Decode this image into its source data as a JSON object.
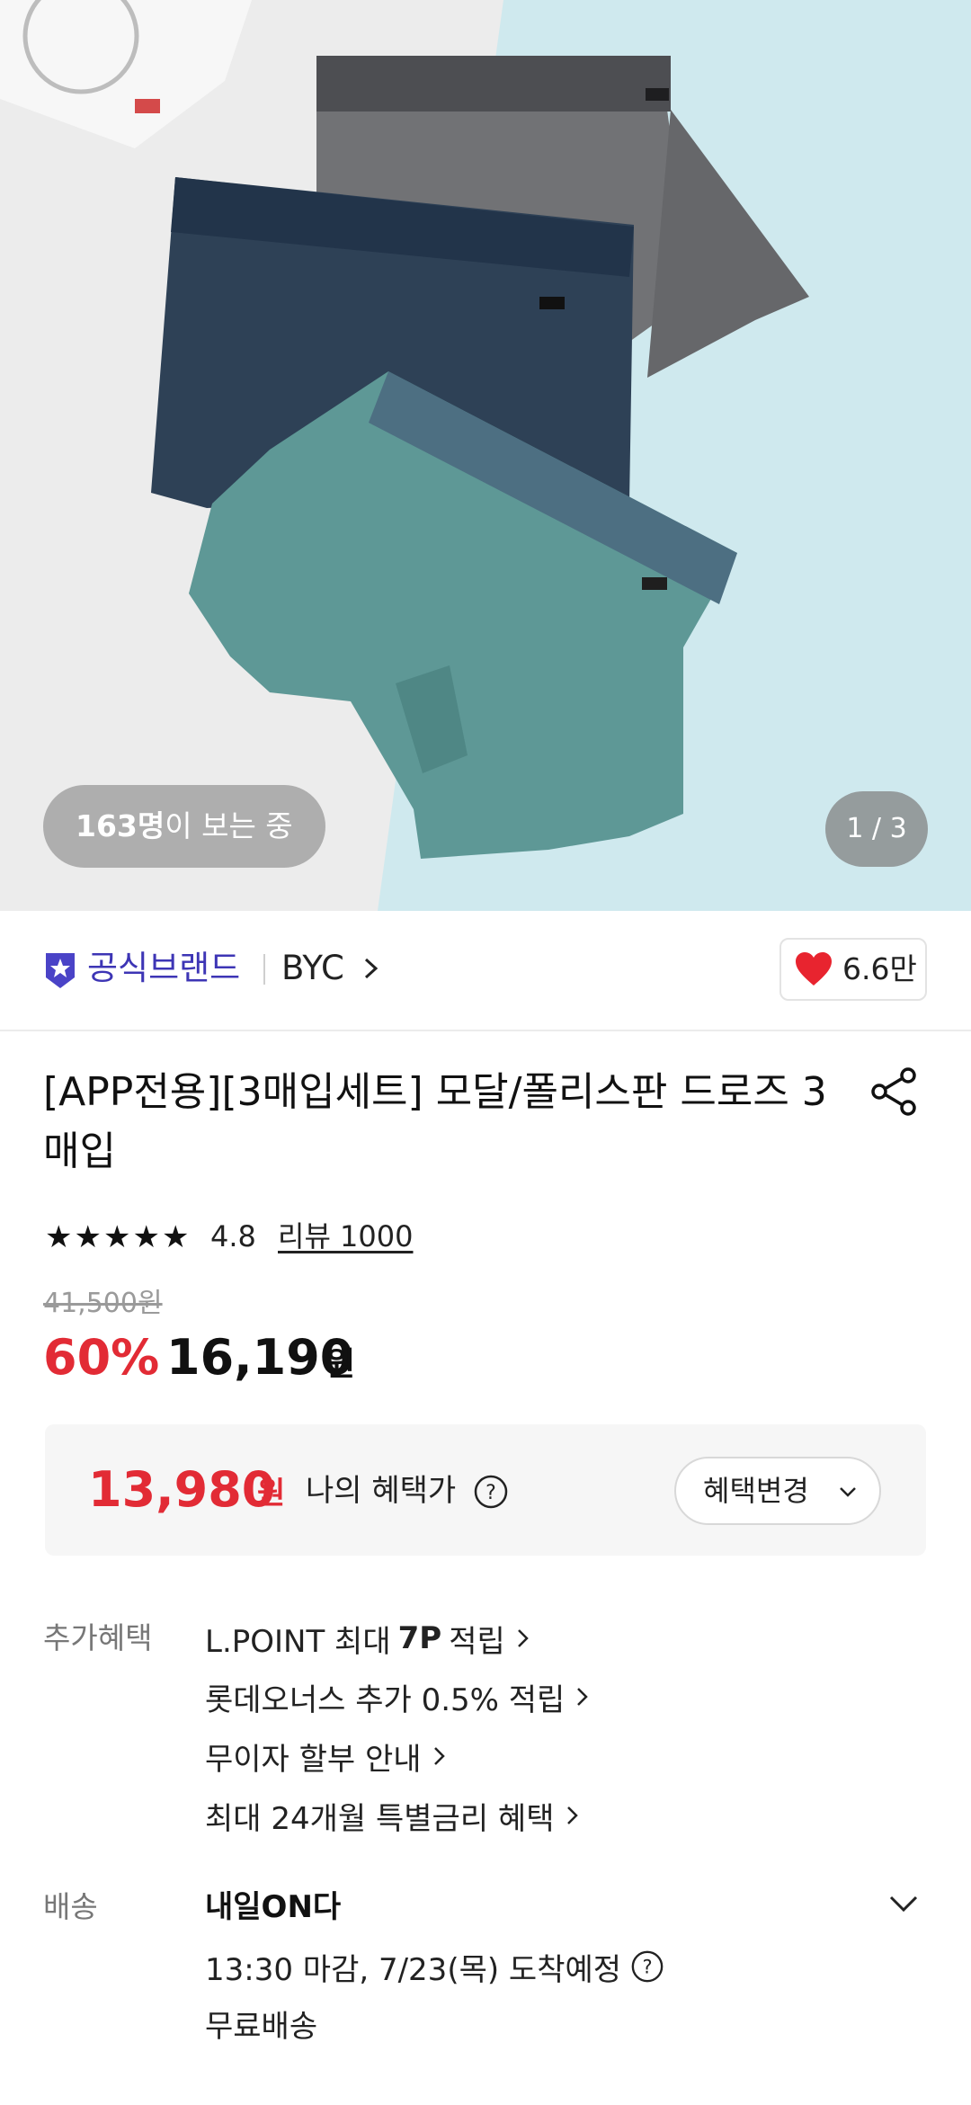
{
  "hero": {
    "viewers_count": "163명",
    "viewers_suffix": "이 보는 중",
    "pager": "1 / 3",
    "colors": {
      "left_bg": "#ececec",
      "right_bg": "#cfe9ee",
      "shorts_gray": "#6b6c6f",
      "shorts_navy": "#2b3e52",
      "shorts_teal": "#5f9a98"
    }
  },
  "brand": {
    "official_label": "공식브랜드",
    "name": "BYC",
    "likes": "6.6만",
    "accent_color": "#3d35b5"
  },
  "product": {
    "title": "[APP전용][3매입세트] 모달/폴리스판 드로즈 3매입",
    "rating": "4.8",
    "reviews": "리뷰 1000",
    "original_price": "41,500원",
    "discount": "60%",
    "price": "16,190",
    "price_unit": "원"
  },
  "benefit_price": {
    "price": "13,980",
    "unit": "원",
    "label": "나의 혜택가",
    "change_button": "혜택변경"
  },
  "extra_benefits": {
    "label": "추가혜택",
    "items": [
      {
        "prefix": "L.POINT 최대",
        "bold": "7P",
        "suffix": "적립"
      },
      {
        "text": "롯데오너스 추가 0.5% 적립"
      },
      {
        "text": "무이자 할부 안내"
      },
      {
        "text": "최대 24개월 특별금리 혜택"
      }
    ]
  },
  "delivery": {
    "label": "배송",
    "title": "내일ON다",
    "time": "13:30 마감, 7/23(목) 도착예정",
    "fee": "무료배송"
  },
  "icons": {
    "badge": "official-badge-icon",
    "heart": "heart-icon",
    "share": "share-icon",
    "help": "help-circle-icon",
    "chevron": "chevron-right-icon"
  }
}
